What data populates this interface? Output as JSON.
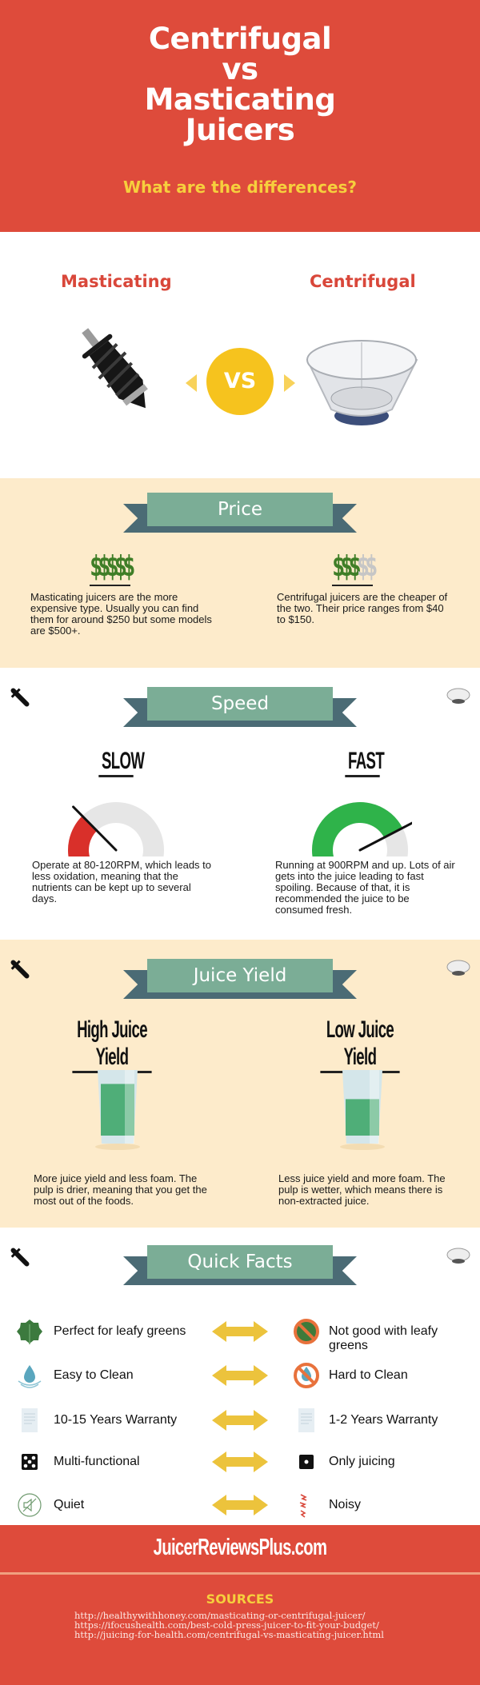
{
  "header": {
    "title_lines": [
      "Centrifugal",
      "vs",
      "Masticating",
      "Juicers"
    ],
    "subtitle": "What are the differences?"
  },
  "versus": {
    "left_label": "Masticating",
    "right_label": "Centrifugal",
    "vs_label": "VS",
    "left_image": "auger-icon",
    "right_image": "centrifugal-bowl-icon"
  },
  "price": {
    "ribbon_label": "Price",
    "masticating": {
      "rating": 5,
      "out_of": 5,
      "symbol": "$",
      "description": "Masticating juicers are the more expensive type. Usually you can find them for around $250 but some models are $500+."
    },
    "centrifugal": {
      "rating": 3,
      "out_of": 5,
      "symbol": "$",
      "description": "Centrifugal juicers are the cheaper of the two. Their price ranges from $40 to $150."
    }
  },
  "speed": {
    "ribbon_label": "Speed",
    "masticating": {
      "heading": "SLOW",
      "gauge_fraction": 0.3,
      "gauge_color": "#d9302a",
      "description": "Operate at 80-120RPM, which leads to less oxidation, meaning that the nutrients can be kept up to several days."
    },
    "centrifugal": {
      "heading": "FAST",
      "gauge_fraction": 0.78,
      "gauge_color": "#2fb34a",
      "description": "Running at 900RPM and up. Lots of air gets into the juice leading to fast spoiling. Because of that, it is recommended the juice to be consumed fresh."
    }
  },
  "yield": {
    "ribbon_label": "Juice Yield",
    "masticating": {
      "heading": "High Juice Yield",
      "fill_fraction": 0.85,
      "description": "More juice yield and less foam. The pulp is drier, meaning that you get the most out of the foods."
    },
    "centrifugal": {
      "heading": "Low Juice Yield",
      "fill_fraction": 0.6,
      "description": "Less juice yield and more foam. The pulp is wetter, which means there is non-extracted juice."
    }
  },
  "facts": {
    "ribbon_label": "Quick Facts",
    "rows": [
      {
        "left_icon": "leaf-icon",
        "left": "Perfect for leafy greens",
        "right_icon": "no-leaf-icon",
        "right": "Not good with leafy greens"
      },
      {
        "left_icon": "water-drop-icon",
        "left": "Easy to Clean",
        "right_icon": "no-water-drop-icon",
        "right": "Hard to Clean"
      },
      {
        "left_icon": "document-icon",
        "left": "10-15 Years Warranty",
        "right_icon": "document-icon",
        "right": "1-2 Years Warranty"
      },
      {
        "left_icon": "dice-five-icon",
        "left": "Multi-functional",
        "right_icon": "dice-one-icon",
        "right": "Only juicing"
      },
      {
        "left_icon": "muted-speaker-icon",
        "left": "Quiet",
        "right_icon": "noise-bolts-icon",
        "right": "Noisy"
      }
    ]
  },
  "footer": {
    "brand": "JuicerReviewsPlus.com",
    "sources_title": "SOURCES",
    "sources": [
      "http://healthywithhoney.com/masticating-or-centrifugal-juicer/",
      "https://ifocushealth.com/best-cold-press-juicer-to-fit-your-budget/",
      "http://juicing-for-health.com/centrifugal-vs-masticating-juicer.html"
    ]
  },
  "colors": {
    "brand_red": "#de4b3b",
    "accent_yellow": "#f6c31e",
    "ribbon_green": "#7bad96",
    "ribbon_dark": "#4b6b75",
    "cream": "#fdebcb",
    "money_green": "#3f7e27"
  }
}
